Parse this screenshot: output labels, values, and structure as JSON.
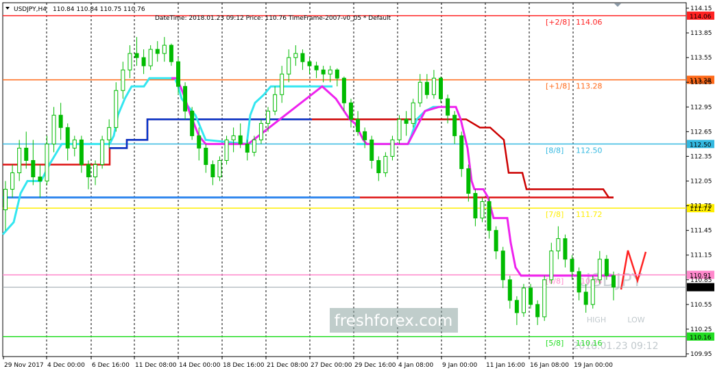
{
  "header": {
    "symbol": "USDJPY,H4",
    "ohlc": "110.84 110.84 110.75 110.76",
    "info": "DateTime: 2018.01.23 09:12    Price: 110.76    TimeFrame-2007-v0_05    *  Default"
  },
  "watermark": {
    "brand": "freshforex.com",
    "pair": "USDJPY",
    "high_label": "HIGH",
    "low_label": "LOW",
    "timestamp": "2018.01.23 09:12"
  },
  "colors": {
    "candle": "#00bb00",
    "cyan_line": "#33e6f0",
    "magenta_line": "#ee22ee",
    "red_step": "#dd1111",
    "blue_step": "#0033cc",
    "dark_red_step": "#cc0000",
    "level_red": "#ff2222",
    "level_orange": "#ff6a1a",
    "level_cyan": "#33b8e0",
    "level_yellow": "#ffee00",
    "level_pink": "#ff88cc",
    "level_gray": "#9aa4ac",
    "level_green": "#22dd22",
    "blue_mid": "#3388ee"
  },
  "chart_data": {
    "type": "candlestick",
    "symbol": "USDJPY",
    "timeframe": "H4",
    "current_price": 110.76,
    "ylim": [
      109.9,
      114.2
    ],
    "price_ticks": [
      "114.15",
      "113.85",
      "113.55",
      "113.25",
      "112.95",
      "112.65",
      "112.35",
      "112.05",
      "111.75",
      "111.45",
      "111.15",
      "110.85",
      "110.55",
      "110.25",
      "109.95"
    ],
    "date_labels": [
      "29 Nov 2017",
      "4 Dec 00:00",
      "6 Dec 16:00",
      "11 Dec 08:00",
      "14 Dec 00:00",
      "18 Dec 16:00",
      "21 Dec 08:00",
      "27 Dec 00:00",
      "29 Dec 16:00",
      "4 Jan 08:00",
      "9 Jan 00:00",
      "11 Jan 16:00",
      "16 Jan 08:00",
      "19 Jan 00:00"
    ],
    "murrey_levels": [
      {
        "label": "[+2/8]",
        "price": "114.06",
        "tag": "114.06",
        "color": "#ff2222"
      },
      {
        "label": "[+1/8]",
        "price": "113.28",
        "tag": "113.28",
        "color": "#ff6a1a"
      },
      {
        "label": "[8/8]",
        "price": "112.50",
        "tag": "112.50",
        "color": "#33b8e0"
      },
      {
        "label": "[7/8]",
        "price": "111.72",
        "tag": "111.72",
        "color": "#ffee00"
      },
      {
        "label": "[6/8]",
        "price": "110.94",
        "tag": "110.91",
        "color": "#ff88cc"
      },
      {
        "label": "[5/8]",
        "price": "110.16",
        "tag": "110.16",
        "color": "#22dd22"
      }
    ],
    "price_line": {
      "price": 110.76,
      "tag": "110.76"
    },
    "series": [
      {
        "name": "",
        "kind": "candles",
        "ohlc": [
          [
            111.7,
            112.05,
            111.45,
            111.95
          ],
          [
            111.95,
            112.25,
            111.85,
            112.15
          ],
          [
            112.15,
            112.55,
            112.05,
            112.45
          ],
          [
            112.45,
            112.65,
            112.2,
            112.3
          ],
          [
            112.3,
            112.55,
            112.0,
            112.1
          ],
          [
            112.1,
            112.25,
            111.85,
            112.05
          ],
          [
            112.05,
            112.6,
            112.0,
            112.5
          ],
          [
            112.5,
            112.95,
            112.4,
            112.85
          ],
          [
            112.85,
            113.0,
            112.55,
            112.7
          ],
          [
            112.7,
            112.75,
            112.3,
            112.45
          ],
          [
            112.45,
            112.6,
            112.35,
            112.55
          ],
          [
            112.55,
            112.6,
            112.15,
            112.25
          ],
          [
            112.25,
            112.3,
            111.95,
            112.1
          ],
          [
            112.1,
            112.3,
            112.0,
            112.25
          ],
          [
            112.25,
            112.6,
            112.2,
            112.55
          ],
          [
            112.55,
            112.8,
            112.45,
            112.7
          ],
          [
            112.7,
            113.25,
            112.65,
            113.15
          ],
          [
            113.15,
            113.5,
            113.05,
            113.4
          ],
          [
            113.4,
            113.7,
            113.3,
            113.6
          ],
          [
            113.6,
            113.8,
            113.45,
            113.55
          ],
          [
            113.55,
            113.65,
            113.35,
            113.45
          ],
          [
            113.45,
            113.7,
            113.4,
            113.65
          ],
          [
            113.65,
            113.75,
            113.5,
            113.6
          ],
          [
            113.6,
            113.8,
            113.5,
            113.7
          ],
          [
            113.7,
            113.72,
            113.45,
            113.5
          ],
          [
            113.5,
            113.55,
            113.1,
            113.2
          ],
          [
            113.2,
            113.25,
            112.8,
            112.9
          ],
          [
            112.9,
            112.95,
            112.55,
            112.6
          ],
          [
            112.6,
            112.7,
            112.3,
            112.45
          ],
          [
            112.45,
            112.5,
            112.15,
            112.25
          ],
          [
            112.25,
            112.3,
            112.0,
            112.1
          ],
          [
            112.1,
            112.35,
            112.05,
            112.3
          ],
          [
            112.3,
            112.6,
            112.25,
            112.55
          ],
          [
            112.55,
            112.7,
            112.4,
            112.6
          ],
          [
            112.6,
            112.75,
            112.45,
            112.5
          ],
          [
            112.5,
            112.55,
            112.3,
            112.4
          ],
          [
            112.4,
            112.6,
            112.35,
            112.55
          ],
          [
            112.55,
            112.8,
            112.5,
            112.75
          ],
          [
            112.75,
            112.95,
            112.65,
            112.9
          ],
          [
            112.9,
            113.2,
            112.85,
            113.1
          ],
          [
            113.1,
            113.45,
            113.0,
            113.35
          ],
          [
            113.35,
            113.65,
            113.25,
            113.55
          ],
          [
            113.55,
            113.7,
            113.45,
            113.6
          ],
          [
            113.6,
            113.65,
            113.4,
            113.5
          ],
          [
            113.5,
            113.55,
            113.35,
            113.45
          ],
          [
            113.45,
            113.5,
            113.3,
            113.4
          ],
          [
            113.4,
            113.45,
            113.25,
            113.35
          ],
          [
            113.35,
            113.45,
            113.25,
            113.4
          ],
          [
            113.4,
            113.42,
            113.2,
            113.3
          ],
          [
            113.3,
            113.32,
            112.9,
            113.0
          ],
          [
            113.0,
            113.05,
            112.7,
            112.8
          ],
          [
            112.8,
            112.9,
            112.6,
            112.65
          ],
          [
            112.65,
            112.7,
            112.45,
            112.55
          ],
          [
            112.55,
            112.6,
            112.2,
            112.3
          ],
          [
            112.3,
            112.35,
            112.05,
            112.15
          ],
          [
            112.15,
            112.4,
            112.1,
            112.35
          ],
          [
            112.35,
            112.6,
            112.3,
            112.55
          ],
          [
            112.55,
            112.85,
            112.5,
            112.8
          ],
          [
            112.8,
            112.9,
            112.6,
            112.75
          ],
          [
            112.75,
            113.05,
            112.7,
            113.0
          ],
          [
            113.0,
            113.35,
            112.95,
            113.25
          ],
          [
            113.25,
            113.35,
            113.05,
            113.1
          ],
          [
            113.1,
            113.4,
            113.05,
            113.3
          ],
          [
            113.3,
            113.32,
            113.0,
            113.05
          ],
          [
            113.05,
            113.1,
            112.75,
            112.85
          ],
          [
            112.85,
            112.9,
            112.5,
            112.6
          ],
          [
            112.6,
            112.65,
            112.1,
            112.2
          ],
          [
            112.2,
            112.25,
            111.8,
            111.9
          ],
          [
            111.9,
            111.95,
            111.5,
            111.6
          ],
          [
            111.6,
            111.85,
            111.55,
            111.8
          ],
          [
            111.8,
            111.85,
            111.35,
            111.45
          ],
          [
            111.45,
            111.5,
            111.1,
            111.2
          ],
          [
            111.2,
            111.25,
            110.75,
            110.85
          ],
          [
            110.85,
            110.9,
            110.5,
            110.6
          ],
          [
            110.6,
            110.65,
            110.3,
            110.45
          ],
          [
            110.45,
            110.8,
            110.4,
            110.75
          ],
          [
            110.75,
            110.8,
            110.5,
            110.55
          ],
          [
            110.55,
            110.6,
            110.3,
            110.4
          ],
          [
            110.4,
            110.9,
            110.35,
            110.85
          ],
          [
            110.85,
            111.3,
            110.8,
            111.2
          ],
          [
            111.2,
            111.5,
            111.1,
            111.35
          ],
          [
            111.35,
            111.4,
            111.0,
            111.1
          ],
          [
            111.1,
            111.15,
            110.85,
            110.95
          ],
          [
            110.95,
            111.0,
            110.6,
            110.7
          ],
          [
            110.7,
            110.8,
            110.45,
            110.55
          ],
          [
            110.55,
            110.9,
            110.5,
            110.85
          ],
          [
            110.85,
            111.2,
            110.8,
            111.1
          ],
          [
            111.1,
            111.15,
            110.85,
            110.9
          ],
          [
            110.9,
            110.95,
            110.6,
            110.76
          ]
        ]
      },
      {
        "name": "",
        "kind": "line",
        "values": [
          111.4,
          111.5,
          111.7,
          111.85,
          111.9,
          111.95,
          112.0,
          112.1,
          112.15,
          112.2,
          112.3,
          112.35,
          112.4,
          112.45,
          112.5,
          112.55,
          112.7,
          112.9,
          113.1,
          113.15,
          113.2,
          113.25,
          113.3,
          113.3,
          113.3,
          113.3,
          113.3,
          113.3,
          113.25,
          113.2,
          112.7,
          112.6,
          112.55,
          112.5,
          112.5,
          112.5,
          112.5,
          112.6,
          112.75,
          112.95,
          113.1,
          113.15,
          113.2,
          113.2,
          113.2,
          113.2,
          113.2,
          113.2,
          113.2,
          113.2,
          113.15,
          113.1,
          113.0,
          112.9,
          112.6,
          112.5,
          112.5,
          112.5,
          112.55,
          112.6,
          112.7,
          112.8,
          112.9,
          112.95,
          112.95,
          112.95,
          112.95,
          112.95,
          112.95,
          112.95,
          112.95,
          112.95,
          112.95,
          112.95,
          112.95,
          112.95,
          112.95,
          112.95,
          112.95,
          112.95,
          112.95,
          112.95,
          112.95,
          112.95,
          112.95,
          112.95,
          112.95,
          112.95,
          112.95
        ]
      }
    ]
  }
}
